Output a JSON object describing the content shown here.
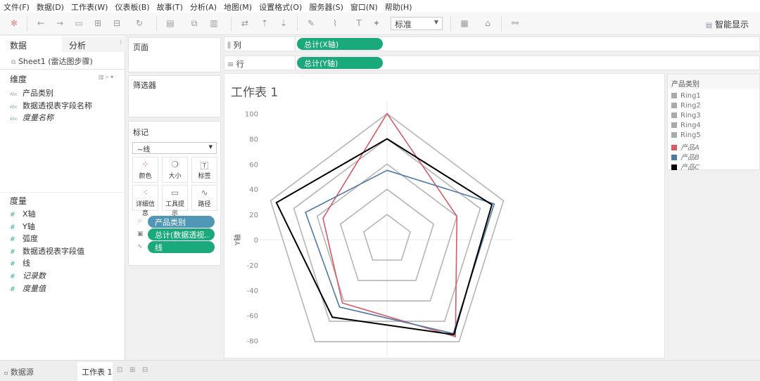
{
  "menu": [
    "文件(F)",
    "数据(D)",
    "工作表(W)",
    "仪表板(B)",
    "故事(T)",
    "分析(A)",
    "地图(M)",
    "设置格式(O)",
    "服务器(S)",
    "窗口(N)",
    "帮助(H)"
  ],
  "toolbar": {
    "fit_select": "标准",
    "smart_show": "智能显示"
  },
  "left_panel": {
    "tab_data": "数据",
    "tab_analysis": "分析",
    "datasource": "Sheet1 (雷达图步骤)",
    "dimensions_header": "维度",
    "dimensions": [
      {
        "label": "产品类别",
        "italic": false
      },
      {
        "label": "数据透视表字段名称",
        "italic": false
      },
      {
        "label": "度量名称",
        "italic": true
      }
    ],
    "measures_header": "度量",
    "measures": [
      {
        "label": "X轴",
        "italic": false
      },
      {
        "label": "Y轴",
        "italic": false
      },
      {
        "label": "弧度",
        "italic": false
      },
      {
        "label": "数据透视表字段值",
        "italic": false
      },
      {
        "label": "线",
        "italic": false
      },
      {
        "label": "记录数",
        "italic": true
      },
      {
        "label": "度量值",
        "italic": true
      }
    ],
    "dim_icon": "Abc",
    "measure_icon": "#"
  },
  "cards": {
    "pages": "页面",
    "filters": "筛选器",
    "marks": "标记",
    "mark_type": "线",
    "mark_buttons": [
      "颜色",
      "大小",
      "标签",
      "详细信息",
      "工具提示",
      "路径"
    ],
    "mark_pills": [
      "产品类别",
      "总计(数据透视..",
      "线"
    ]
  },
  "shelves": {
    "columns_label": "列",
    "columns_pill": "总计(X轴)",
    "rows_label": "行",
    "rows_pill": "总计(Y轴)"
  },
  "sheet_title": "工作表 1",
  "legend": {
    "title": "产品类别",
    "items": [
      {
        "label": "Ring1",
        "color": "#aaaaaa"
      },
      {
        "label": "Ring2",
        "color": "#aaaaaa"
      },
      {
        "label": "Ring3",
        "color": "#aaaaaa"
      },
      {
        "label": "Ring4",
        "color": "#aaaaaa"
      },
      {
        "label": "Ring5",
        "color": "#aaaaaa"
      },
      {
        "label": "产品A",
        "color": "#d65a68"
      },
      {
        "label": "产品B",
        "color": "#4e79a7"
      },
      {
        "label": "产品C",
        "color": "#000000"
      }
    ]
  },
  "bottom": {
    "datasource_tab": "数据源",
    "sheet_tab": "工作表 1"
  },
  "chart_data": {
    "type": "line",
    "subtype": "radar",
    "title": "工作表 1",
    "ylabel": "Y轴",
    "xlabel": "",
    "yticks": [
      100,
      80,
      60,
      40,
      20,
      0,
      -20,
      -40,
      -60,
      -80
    ],
    "ylim": [
      -90,
      105
    ],
    "grid": "zero-lines",
    "spokes": 5,
    "rings": [
      {
        "name": "Ring1",
        "radius": 20
      },
      {
        "name": "Ring2",
        "radius": 40
      },
      {
        "name": "Ring3",
        "radius": 60
      },
      {
        "name": "Ring4",
        "radius": 80
      },
      {
        "name": "Ring5",
        "radius": 100
      }
    ],
    "series": [
      {
        "name": "产品A",
        "color": "#d65a68",
        "values": [
          100,
          60,
          95,
          62,
          55
        ]
      },
      {
        "name": "产品B",
        "color": "#4e79a7",
        "values": [
          55,
          92,
          92,
          66,
          70
        ]
      },
      {
        "name": "产品C",
        "color": "#000000",
        "values": [
          80,
          90,
          93,
          76,
          95
        ]
      }
    ],
    "legend": "right"
  }
}
